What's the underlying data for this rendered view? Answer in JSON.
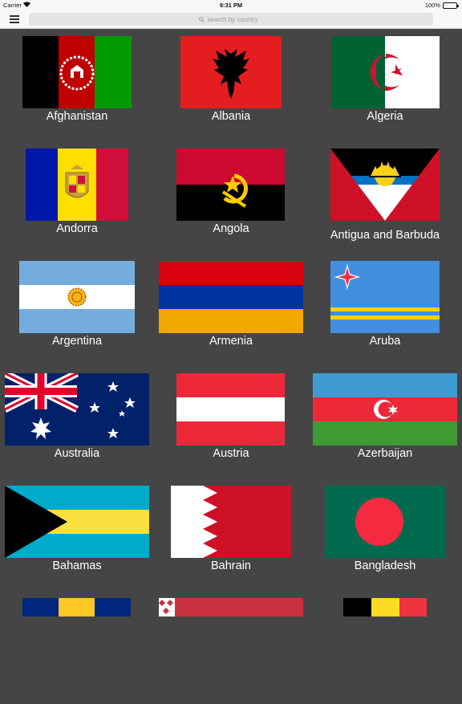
{
  "status_bar": {
    "carrier": "Carrier",
    "time": "9:31 PM",
    "battery": "100%"
  },
  "search": {
    "placeholder": "search by country"
  },
  "countries": [
    {
      "name": "Afghanistan"
    },
    {
      "name": "Albania"
    },
    {
      "name": "Algeria"
    },
    {
      "name": "Andorra"
    },
    {
      "name": "Angola"
    },
    {
      "name": "Antigua and Barbuda"
    },
    {
      "name": "Argentina"
    },
    {
      "name": "Armenia"
    },
    {
      "name": "Aruba"
    },
    {
      "name": "Australia"
    },
    {
      "name": "Austria"
    },
    {
      "name": "Azerbaijan"
    },
    {
      "name": "Bahamas"
    },
    {
      "name": "Bahrain"
    },
    {
      "name": "Bangladesh"
    }
  ]
}
